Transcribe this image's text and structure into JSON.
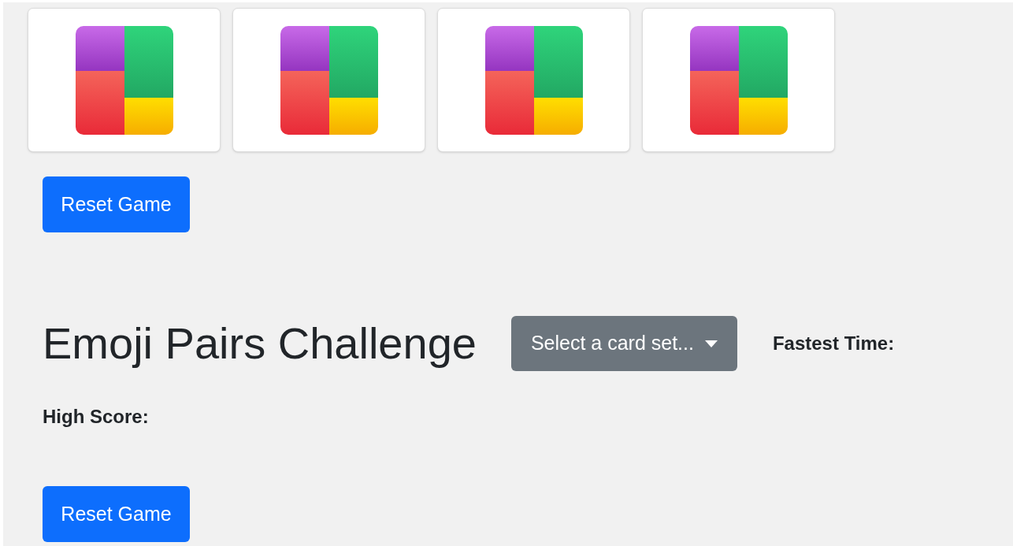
{
  "cards": [
    {
      "kind": "back"
    },
    {
      "kind": "back"
    },
    {
      "kind": "back"
    },
    {
      "kind": "back"
    }
  ],
  "top_button": "Reset Game",
  "title": "Emoji Pairs Challenge",
  "card_set_dropdown": {
    "label": "Select a card set..."
  },
  "fastest_time_label": "Fastest Time:",
  "high_score_label": "High Score:",
  "bottom_button": "Reset Game"
}
